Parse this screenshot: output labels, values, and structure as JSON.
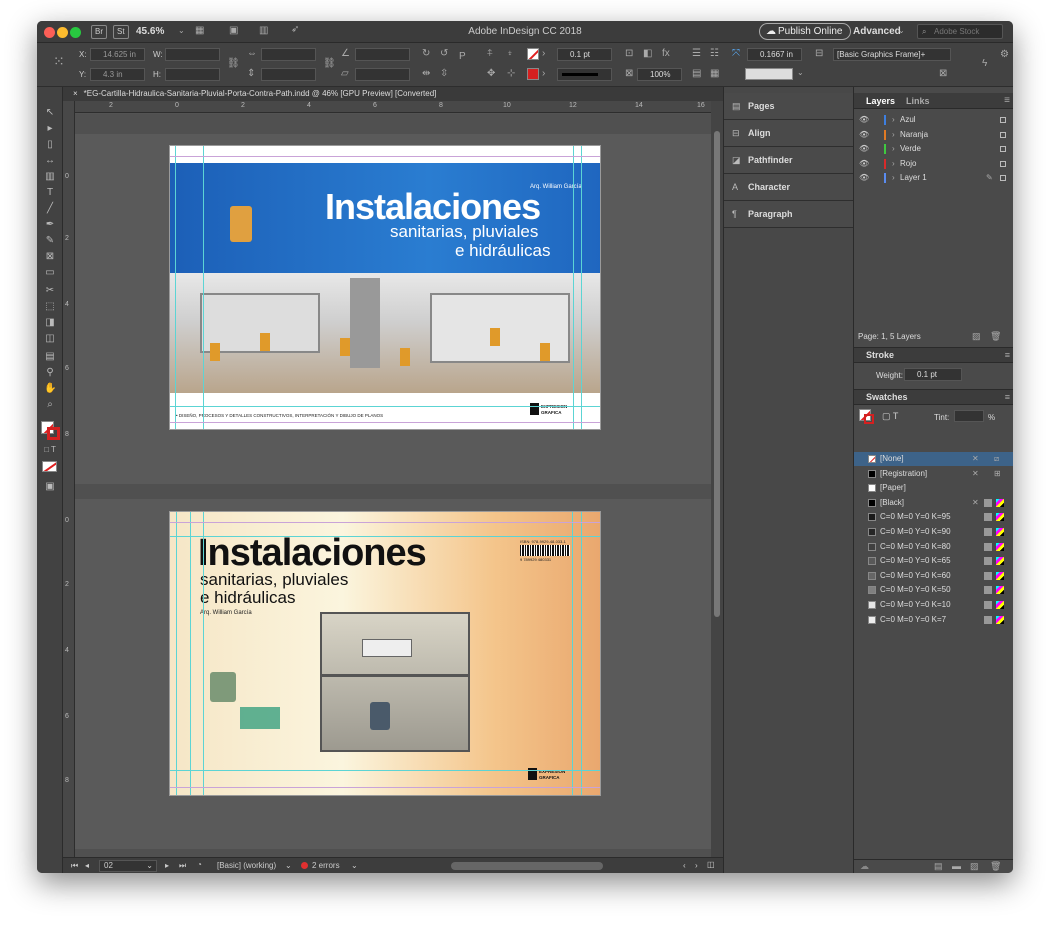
{
  "titlebar": {
    "zoom": "45.6%",
    "app_title": "Adobe InDesign CC 2018",
    "publish": "Publish Online",
    "workspace": "Advanced",
    "stock_search_placeholder": "Adobe Stock",
    "br": "Br",
    "st": "St"
  },
  "control": {
    "x_label": "X:",
    "x_value": "14.625 in",
    "y_label": "Y:",
    "y_value": "4.3 in",
    "w_label": "W:",
    "h_label": "H:",
    "stroke_weight": "0.1 pt",
    "scale": "100%",
    "ref_value": "0.1667 in",
    "object_style": "[Basic Graphics Frame]+"
  },
  "document_tab": {
    "name": "*EG-Cartilla-Hidraulica-Sanitaria-Pluvial-Porta-Contra-Path.indd @ 46% [GPU Preview] [Converted]"
  },
  "ruler": {
    "h": [
      "2",
      "0",
      "2",
      "4",
      "6",
      "8",
      "10",
      "12",
      "14",
      "16"
    ],
    "v1": [
      "0",
      "2",
      "4",
      "6",
      "8"
    ],
    "v2": [
      "0",
      "2",
      "4",
      "6",
      "8"
    ]
  },
  "cover_front": {
    "title": "Instalaciones",
    "subtitle1": "sanitarias, pluviales",
    "subtitle2": "e hidráulicas",
    "author": "Arq. William García",
    "footer": "• DISEÑO, PROCESOS Y DETALLES CONSTRUCTIVOS, INTERPRETACIÓN Y DIBUJO DE PLANOS",
    "publisher1": "EXPRESION",
    "publisher2": "GRAFICA"
  },
  "cover_back": {
    "title": "Instalaciones",
    "subtitle1": "sanitarias, pluviales",
    "subtitle2": "e hidráulicas",
    "author": "Arq. William García",
    "isbn": "ISBN: 978-9929-48-033-1",
    "barcode_digits": "9 789929 480331",
    "publisher1": "EXPRESION",
    "publisher2": "GRAFICA"
  },
  "status": {
    "page": "02",
    "preflight_profile": "[Basic] (working)",
    "errors": "2 errors"
  },
  "panels_a": [
    {
      "icon": "▤",
      "label": "Pages"
    },
    {
      "icon": "⊟",
      "label": "Align"
    },
    {
      "icon": "◪",
      "label": "Pathfinder"
    },
    {
      "icon": "A",
      "label": "Character"
    },
    {
      "icon": "¶",
      "label": "Paragraph"
    }
  ],
  "layers_panel": {
    "tab_layers": "Layers",
    "tab_links": "Links",
    "footer": "Page: 1, 5 Layers",
    "layers": [
      {
        "name": "Azul",
        "color": "#3d7fe0"
      },
      {
        "name": "Naranja",
        "color": "#e07a24"
      },
      {
        "name": "Verde",
        "color": "#3fc940"
      },
      {
        "name": "Rojo",
        "color": "#d92a2a"
      },
      {
        "name": "Layer 1",
        "color": "#5a8cf0"
      }
    ]
  },
  "stroke_panel": {
    "title": "Stroke",
    "weight_label": "Weight:",
    "weight_value": "0.1 pt"
  },
  "swatches_panel": {
    "title": "Swatches",
    "tint_label": "Tint:",
    "tint_unit": "%",
    "swatches": [
      {
        "name": "[None]",
        "color": "none"
      },
      {
        "name": "[Registration]",
        "color": "#000000"
      },
      {
        "name": "[Paper]",
        "color": "#ffffff"
      },
      {
        "name": "[Black]",
        "color": "#000000"
      },
      {
        "name": "C=0 M=0 Y=0 K=95",
        "color": "#1a1a1a"
      },
      {
        "name": "C=0 M=0 Y=0 K=90",
        "color": "#262626"
      },
      {
        "name": "C=0 M=0 Y=0 K=80",
        "color": "#404040"
      },
      {
        "name": "C=0 M=0 Y=0 K=65",
        "color": "#595959"
      },
      {
        "name": "C=0 M=0 Y=0 K=60",
        "color": "#666666"
      },
      {
        "name": "C=0 M=0 Y=0 K=50",
        "color": "#808080"
      },
      {
        "name": "C=0 M=0 Y=0 K=10",
        "color": "#e6e6e6"
      },
      {
        "name": "C=0 M=0 Y=0 K=7",
        "color": "#ededed"
      }
    ]
  }
}
